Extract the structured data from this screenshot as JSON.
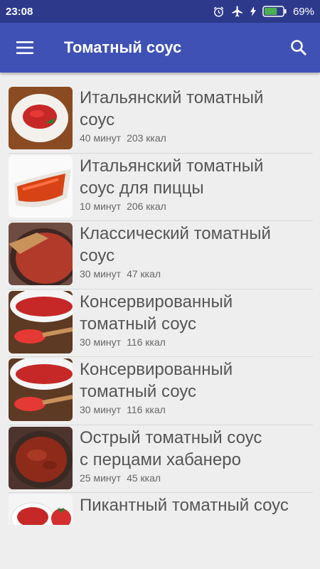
{
  "status_bar": {
    "time": "23:08",
    "battery": "69%",
    "battery_level": 0.69
  },
  "app_bar": {
    "title": "Томатный соус"
  },
  "recipes": [
    {
      "title_line1": "Итальянский томатный",
      "title_line2": "соус",
      "time": "40 минут",
      "kcal": "203 ккал"
    },
    {
      "title_line1": "Итальянский томатный",
      "title_line2": "соус для пиццы",
      "time": "10 минут",
      "kcal": "206 ккал"
    },
    {
      "title_line1": "Классический томатный",
      "title_line2": "соус",
      "time": "30 минут",
      "kcal": "47 ккал"
    },
    {
      "title_line1": "Консервированный",
      "title_line2": "томатный соус",
      "time": "30 минут",
      "kcal": "116 ккал"
    },
    {
      "title_line1": "Консервированный",
      "title_line2": "томатный соус",
      "time": "30 минут",
      "kcal": "116 ккал"
    },
    {
      "title_line1": "Острый томатный соус",
      "title_line2": "с перцами хабанеро",
      "time": "25 минут",
      "kcal": "45 ккал"
    },
    {
      "title_line1": "Пикантный томатный соус",
      "title_line2": "",
      "time": "",
      "kcal": ""
    }
  ],
  "colors": {
    "status_bar": "#2d3a8c",
    "app_bar": "#3f51b5",
    "background": "#eeeeee"
  },
  "icons": {
    "menu": "hamburger-icon",
    "search": "search-icon",
    "alarm": "alarm-icon",
    "airplane": "airplane-icon",
    "battery": "battery-icon"
  }
}
